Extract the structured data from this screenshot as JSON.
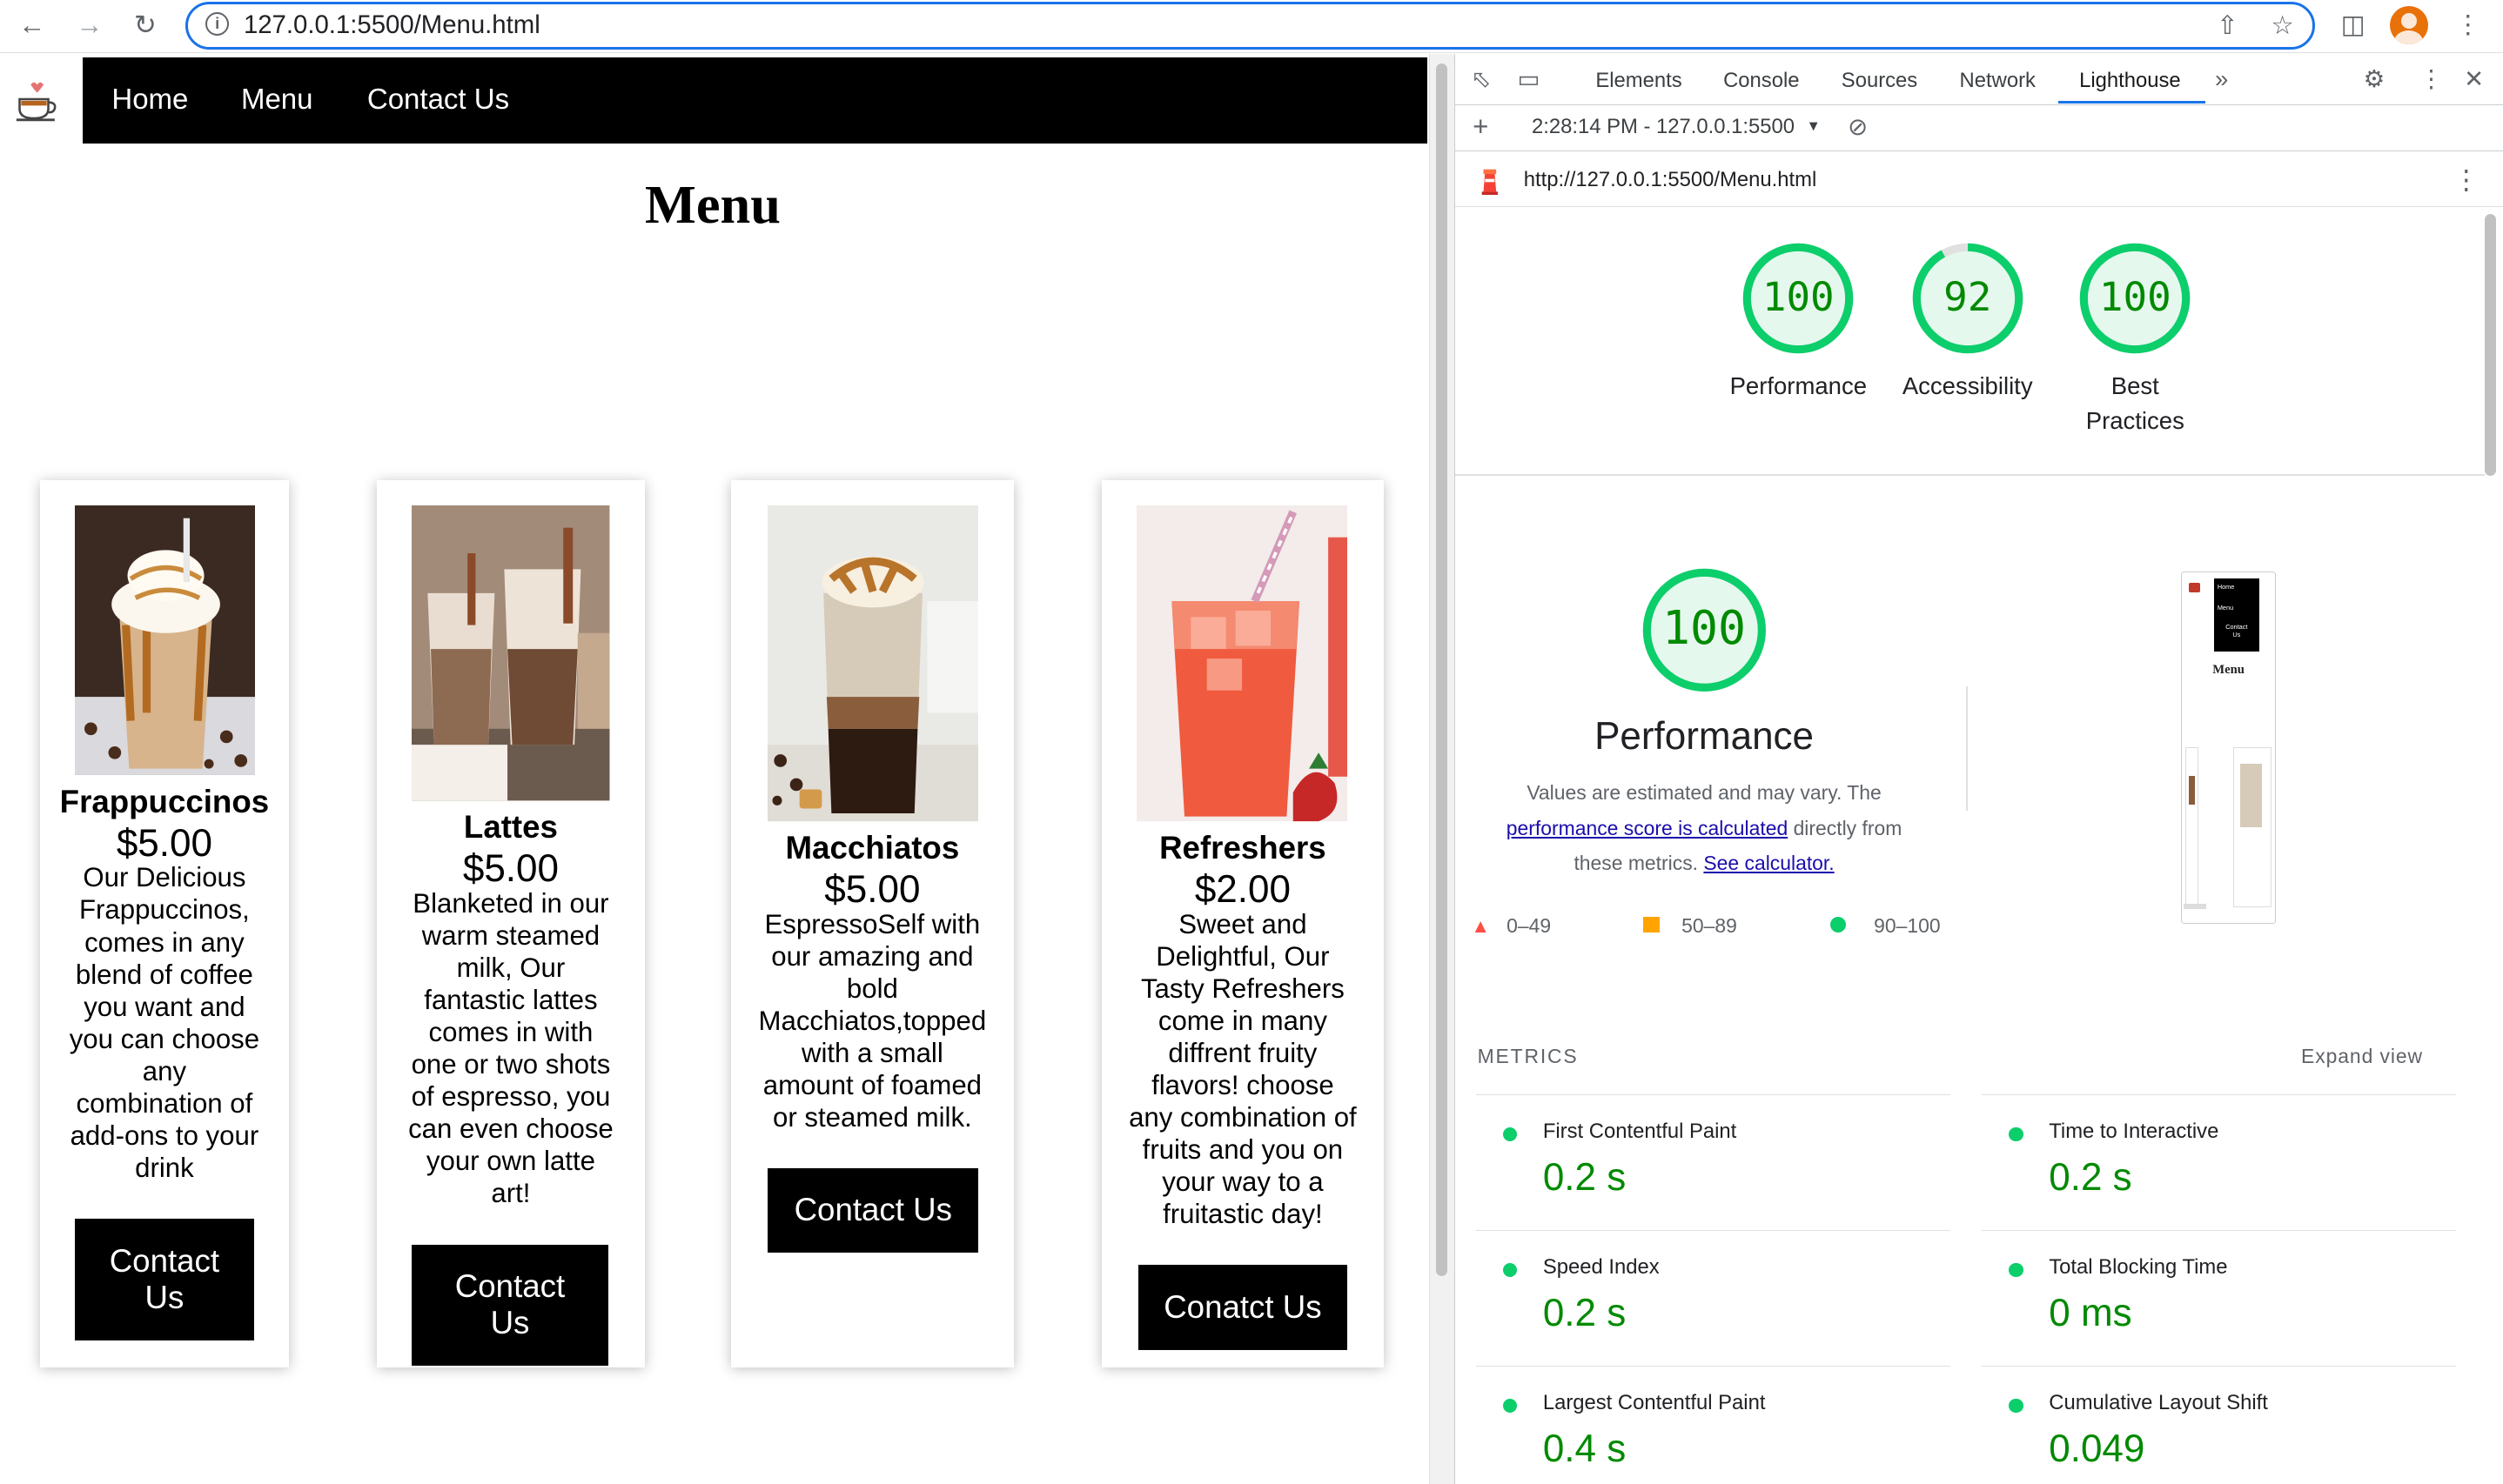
{
  "browser": {
    "url": "127.0.0.1:5500/Menu.html"
  },
  "site": {
    "nav": [
      "Home",
      "Menu",
      "Contact Us"
    ],
    "title": "Menu",
    "cards": [
      {
        "name": "Frappuccinos",
        "price": "$5.00",
        "desc": [
          "Our Delicious",
          "Frappuccinos,",
          "comes in any",
          "blend of coffee",
          "you want and",
          "you can choose",
          "any",
          "combination of",
          "add-ons to your",
          "drink"
        ],
        "button": [
          "Contact",
          "Us"
        ]
      },
      {
        "name": "Lattes",
        "price": "$5.00",
        "desc": [
          "Blanketed in our",
          "warm steamed",
          "milk, Our",
          "fantastic lattes",
          "comes in with",
          "one or two shots",
          "of espresso, you",
          "can even choose",
          "your own latte",
          "art!"
        ],
        "button": [
          "Contact",
          "Us"
        ]
      },
      {
        "name": "Macchiatos",
        "price": "$5.00",
        "desc": [
          "EspressoSelf with",
          "our amazing and",
          "bold",
          "Macchiatos,topped",
          "with a small",
          "amount of foamed",
          "or steamed milk."
        ],
        "button": [
          "Contact Us"
        ]
      },
      {
        "name": "Refreshers",
        "price": "$2.00",
        "desc": [
          "Sweet and",
          "Delightful, Our",
          "Tasty Refreshers",
          "come in many",
          "diffrent fruity",
          "flavors! choose",
          "any combination of",
          "fruits and you on",
          "your way to a",
          "fruitastic day!"
        ],
        "button": [
          "Conatct Us"
        ]
      }
    ]
  },
  "devtools": {
    "tabs": [
      "Elements",
      "Console",
      "Sources",
      "Network",
      "Lighthouse"
    ],
    "active_tab": "Lighthouse",
    "report_time": "2:28:14 PM - 127.0.0.1:5500",
    "report_url": "http://127.0.0.1:5500/Menu.html",
    "scores": [
      {
        "value": "100",
        "label": [
          "Performance"
        ],
        "fraction": 1.0
      },
      {
        "value": "92",
        "label": [
          "Accessibility"
        ],
        "fraction": 0.92
      },
      {
        "value": "100",
        "label": [
          "Best",
          "Practices"
        ],
        "fraction": 1.0
      }
    ],
    "perf": {
      "score": "100",
      "fraction": 1.0,
      "title": "Performance",
      "desc_1": "Values are estimated and may vary. The",
      "link_1": "performance score is calculated",
      "desc_2": "directly from",
      "desc_3": "these metrics.",
      "link_2": "See calculator."
    },
    "legend": [
      {
        "range": "0–49",
        "color": "#ff4e42",
        "shape": "triangle"
      },
      {
        "range": "50–89",
        "color": "#ffa400",
        "shape": "square"
      },
      {
        "range": "90–100",
        "color": "#0cce6b",
        "shape": "circle"
      }
    ],
    "thumbnail": {
      "nav": [
        "Home",
        "Menu",
        "Contact",
        "Us"
      ],
      "title": "Menu"
    },
    "metrics_header": "METRICS",
    "expand_label": "Expand view",
    "metrics": [
      {
        "name": "First Contentful Paint",
        "value": "0.2 s"
      },
      {
        "name": "Time to Interactive",
        "value": "0.2 s"
      },
      {
        "name": "Speed Index",
        "value": "0.2 s"
      },
      {
        "name": "Total Blocking Time",
        "value": "0 ms"
      },
      {
        "name": "Largest Contentful Paint",
        "value": "0.4 s"
      },
      {
        "name": "Cumulative Layout Shift",
        "value": "0.049"
      }
    ],
    "colors": {
      "pass": "#0cce6b",
      "pass_text": "#008a00",
      "accent": "#1a73e8"
    }
  }
}
